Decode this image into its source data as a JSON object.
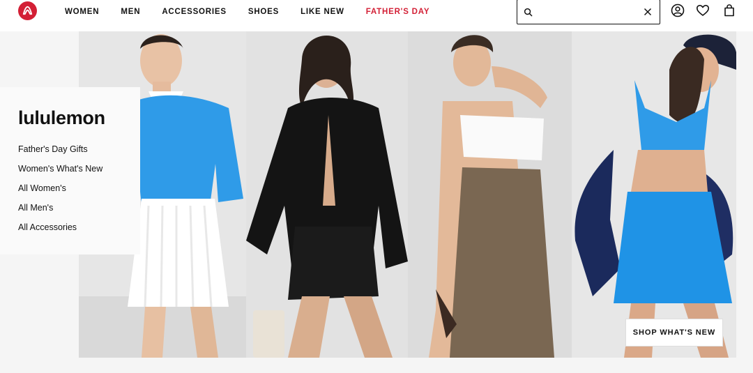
{
  "header": {
    "logo_icon": "lululemon-logo-icon",
    "nav": [
      {
        "label": "WOMEN"
      },
      {
        "label": "MEN"
      },
      {
        "label": "ACCESSORIES"
      },
      {
        "label": "SHOES"
      },
      {
        "label": "LIKE NEW"
      },
      {
        "label": "FATHER'S DAY",
        "color": "#d31f35"
      }
    ],
    "search": {
      "value": "",
      "placeholder": "",
      "icon": "search-icon",
      "clear_icon": "close-icon"
    },
    "utility_icons": [
      "account-icon",
      "wishlist-heart-icon",
      "shopping-bag-icon"
    ]
  },
  "promo": {
    "brand": "lululemon",
    "links": [
      "Father's Day Gifts",
      "Women's What's New",
      "All Women's",
      "All Men's",
      "All Accessories"
    ]
  },
  "hero": {
    "cta_label": "SHOP WHAT'S NEW",
    "panels": [
      "model-white-skirt-blue-top",
      "model-black-shirt-shorts",
      "model-white-bandeau-brown-skirt",
      "model-blue-crop-top-skirt"
    ]
  },
  "colors": {
    "brand_red": "#d31f35",
    "hero_blue": "#2f9be8"
  }
}
